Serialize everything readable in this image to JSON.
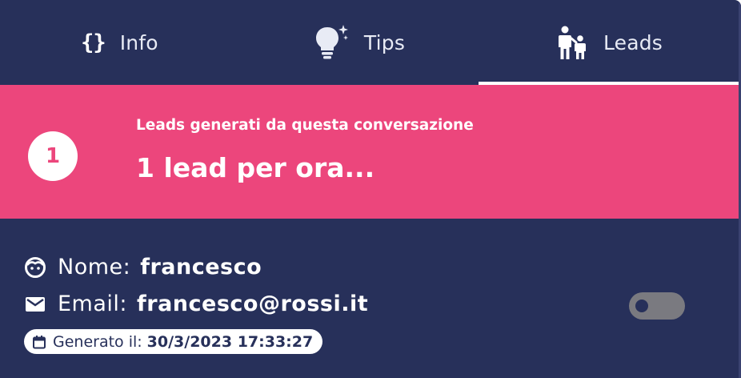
{
  "tabs": [
    {
      "label": "Info",
      "icon": "braces-icon",
      "icon_text": "{}"
    },
    {
      "label": "Tips",
      "icon": "lightbulb-icon"
    },
    {
      "label": "Leads",
      "icon": "parent-child-icon",
      "active": true
    }
  ],
  "banner": {
    "count": "1",
    "subtitle": "Leads generati da questa conversazione",
    "title": "1 lead per ora...",
    "color": "#ec467c"
  },
  "lead": {
    "name_label": "Nome:",
    "name_value": "francesco",
    "email_label": "Email:",
    "email_value": "francesco@rossi.it",
    "generated_label": "Generato il:",
    "generated_value": "30/3/2023 17:33:27",
    "toggle_on": false
  },
  "colors": {
    "background": "#27305a",
    "accent": "#ec467c",
    "toggle": "#7a7a80"
  }
}
